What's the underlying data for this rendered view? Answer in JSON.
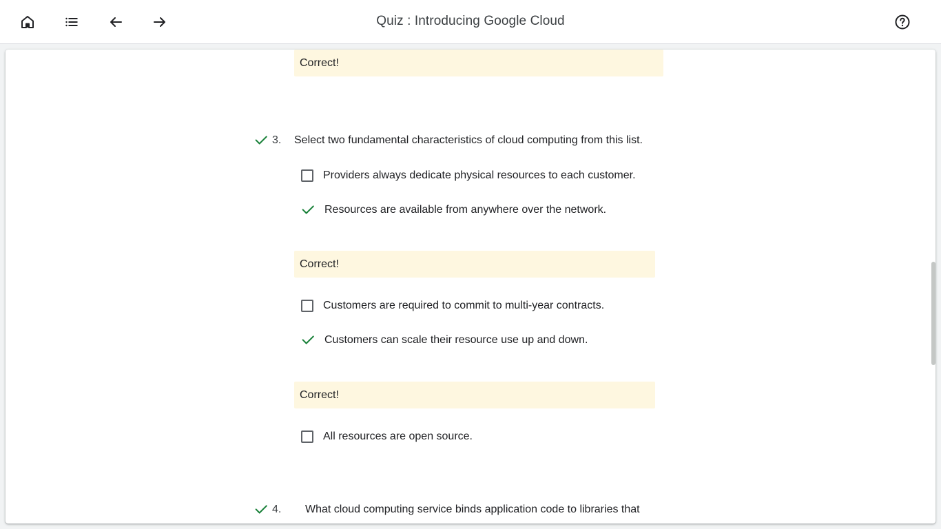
{
  "header": {
    "title": "Quiz : Introducing Google Cloud",
    "home_icon": "home-icon",
    "list_icon": "list-icon",
    "back_icon": "arrow-back-icon",
    "forward_icon": "arrow-forward-icon",
    "help_icon": "help-icon"
  },
  "colors": {
    "feedback_bg": "#fef7e0",
    "correct_green": "#188038",
    "checkbox_border": "#5f6368"
  },
  "prev_feedback": "Correct!",
  "question3": {
    "number": "3.",
    "status": "correct",
    "text": "Select two fundamental characteristics of cloud computing from this list.",
    "options": [
      {
        "text": "Providers always dedicate physical resources to each customer.",
        "selected": false
      },
      {
        "text": "Resources are available from anywhere over the network.",
        "selected": true,
        "feedback": "Correct!"
      },
      {
        "text": "Customers are required to commit to multi-year contracts.",
        "selected": false
      },
      {
        "text": "Customers can scale their resource use up and down.",
        "selected": true,
        "feedback": "Correct!"
      },
      {
        "text": "All resources are open source.",
        "selected": false
      }
    ]
  },
  "question4": {
    "number": "4.",
    "status": "correct",
    "text": "What cloud computing service binds application code to libraries that"
  }
}
